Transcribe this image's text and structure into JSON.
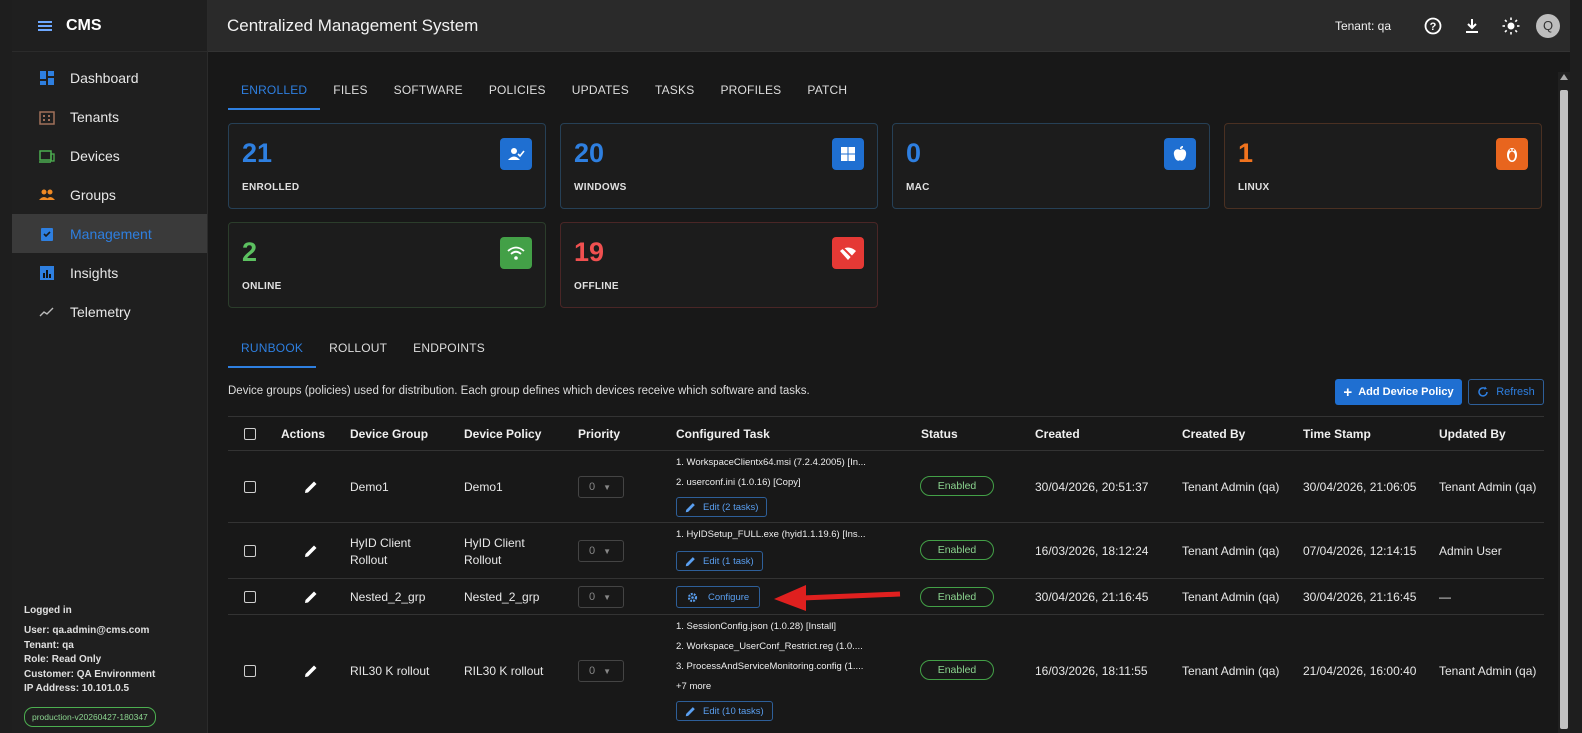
{
  "app": {
    "brand": "CMS",
    "title": "Centralized Management System",
    "tenant_label": "Tenant: qa",
    "avatar_letter": "Q"
  },
  "sidebar": {
    "items": [
      {
        "label": "Dashboard",
        "icon": "dashboard-icon",
        "color": "#2e7fe0"
      },
      {
        "label": "Tenants",
        "icon": "building-icon",
        "color": "#a0705a"
      },
      {
        "label": "Devices",
        "icon": "devices-icon",
        "color": "#4caf50"
      },
      {
        "label": "Groups",
        "icon": "groups-icon",
        "color": "#f08a24"
      },
      {
        "label": "Management",
        "icon": "clipboard-check-icon",
        "color": "#2e7fe0"
      },
      {
        "label": "Insights",
        "icon": "bar-chart-icon",
        "color": "#2e7fe0"
      },
      {
        "label": "Telemetry",
        "icon": "trend-line-icon",
        "color": "#bbbbbb"
      }
    ],
    "footer": {
      "heading": "Logged in",
      "user": "User: qa.admin@cms.com",
      "tenant": "Tenant: qa",
      "role": "Role: Read Only",
      "customer": "Customer: QA Environment",
      "ip": "IP Address: 10.101.0.5",
      "version": "production-v20260427-180347"
    }
  },
  "tabs": [
    "ENROLLED",
    "FILES",
    "SOFTWARE",
    "POLICIES",
    "UPDATES",
    "TASKS",
    "PROFILES",
    "PATCH"
  ],
  "cards": [
    {
      "value": "21",
      "label": "ENROLLED",
      "color": "#2e7fe0",
      "icon": "user-check-icon",
      "icon_bg": "#1f6fd1"
    },
    {
      "value": "20",
      "label": "WINDOWS",
      "color": "#2e7fe0",
      "icon": "windows-icon",
      "icon_bg": "#1f6fd1"
    },
    {
      "value": "0",
      "label": "MAC",
      "color": "#2e7fe0",
      "icon": "apple-icon",
      "icon_bg": "#1f6fd1"
    },
    {
      "value": "1",
      "label": "LINUX",
      "color": "#f0731e",
      "icon": "linux-icon",
      "icon_bg": "#e8651e"
    },
    {
      "value": "2",
      "label": "ONLINE",
      "color": "#5cc160",
      "icon": "wifi-icon",
      "icon_bg": "#43a047"
    },
    {
      "value": "19",
      "label": "OFFLINE",
      "color": "#f05050",
      "icon": "wifi-off-icon",
      "icon_bg": "#e53935"
    }
  ],
  "subtabs": [
    "RUNBOOK",
    "ROLLOUT",
    "ENDPOINTS"
  ],
  "description": "Device groups (policies) used for distribution. Each group defines which devices receive which software and tasks.",
  "buttons": {
    "add": "Add Device Policy",
    "refresh": "Refresh"
  },
  "table": {
    "headers": [
      "Actions",
      "Device Group",
      "Device Policy",
      "Priority",
      "Configured Task",
      "Status",
      "Created",
      "Created By",
      "Time Stamp",
      "Updated By"
    ],
    "rows": [
      {
        "group": "Demo1",
        "policy": "Demo1",
        "priority": "0",
        "tasks": [
          "1. WorkspaceClientx64.msi (7.2.4.2005) [In...",
          "2. userconf.ini (1.0.16) [Copy]"
        ],
        "more": "",
        "action": "Edit (2 tasks)",
        "status": "Enabled",
        "created": "30/04/2026, 20:51:37",
        "created_by": "Tenant Admin (qa)",
        "timestamp": "30/04/2026, 21:06:05",
        "updated_by": "Tenant Admin (qa)"
      },
      {
        "group": "HyID Client Rollout",
        "policy": "HyID Client Rollout",
        "priority": "0",
        "tasks": [
          "1. HyIDSetup_FULL.exe (hyid1.1.19.6) [Ins..."
        ],
        "more": "",
        "action": "Edit (1 task)",
        "status": "Enabled",
        "created": "16/03/2026, 18:12:24",
        "created_by": "Tenant Admin (qa)",
        "timestamp": "07/04/2026, 12:14:15",
        "updated_by": "Admin User"
      },
      {
        "group": "Nested_2_grp",
        "policy": "Nested_2_grp",
        "priority": "0",
        "tasks": [],
        "more": "",
        "action": "Configure",
        "status": "Enabled",
        "created": "30/04/2026, 21:16:45",
        "created_by": "Tenant Admin (qa)",
        "timestamp": "30/04/2026, 21:16:45",
        "updated_by": "—"
      },
      {
        "group": "RIL30 K rollout",
        "policy": "RIL30 K rollout",
        "priority": "0",
        "tasks": [
          "1. SessionConfig.json (1.0.28) [Install]",
          "2. Workspace_UserConf_Restrict.reg (1.0....",
          "3. ProcessAndServiceMonitoring.config (1...."
        ],
        "more": "+7 more",
        "action": "Edit (10 tasks)",
        "status": "Enabled",
        "created": "16/03/2026, 18:11:55",
        "created_by": "Tenant Admin (qa)",
        "timestamp": "21/04/2026, 16:00:40",
        "updated_by": "Tenant Admin (qa)"
      }
    ]
  }
}
